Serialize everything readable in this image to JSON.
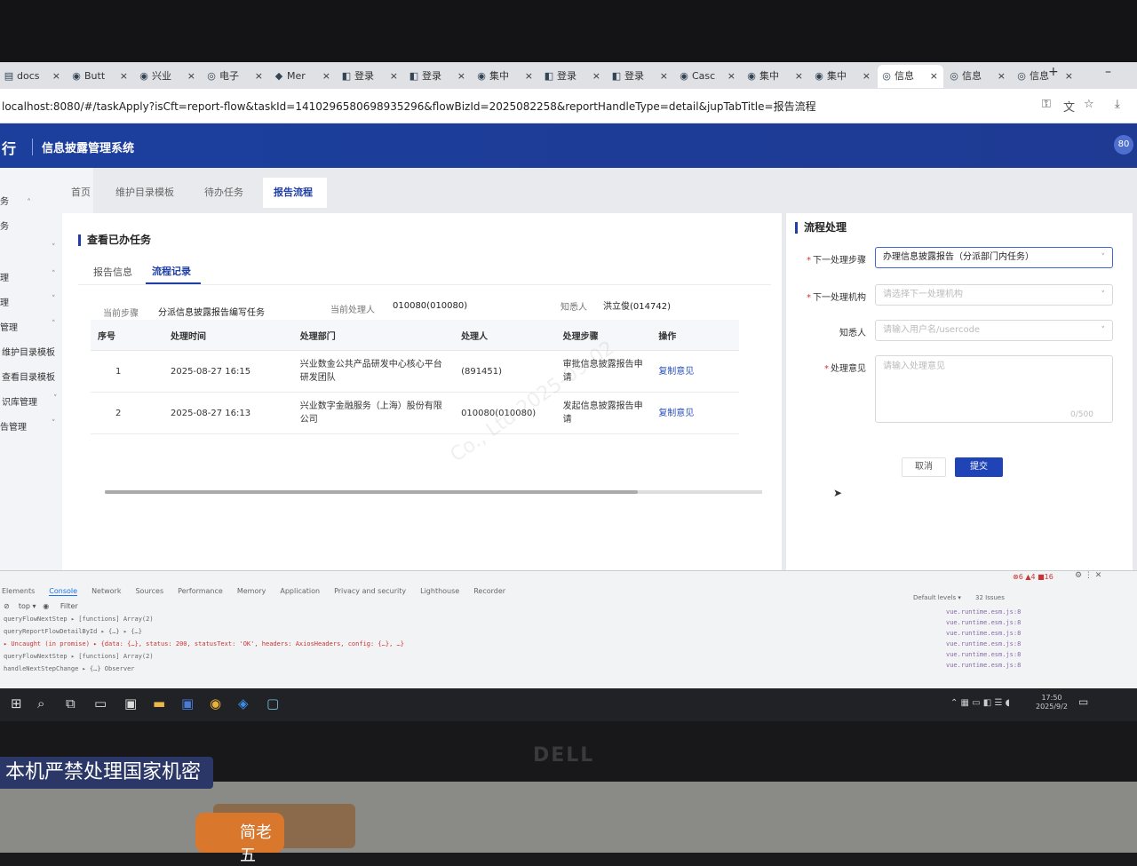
{
  "browser": {
    "tabs": [
      {
        "label": "docs",
        "icon": "doc"
      },
      {
        "label": "Butt",
        "icon": "globe"
      },
      {
        "label": "兴业",
        "icon": "globe"
      },
      {
        "label": "电子",
        "icon": "eye"
      },
      {
        "label": "Mer",
        "icon": "gitlab"
      },
      {
        "label": "登录",
        "icon": "d"
      },
      {
        "label": "登录",
        "icon": "d"
      },
      {
        "label": "集中",
        "icon": "globe"
      },
      {
        "label": "登录",
        "icon": "d"
      },
      {
        "label": "登录",
        "icon": "d"
      },
      {
        "label": "Casc",
        "icon": "globe"
      },
      {
        "label": "集中",
        "icon": "globe"
      },
      {
        "label": "集中",
        "icon": "globe"
      },
      {
        "label": "信息",
        "icon": "eye",
        "active": true
      },
      {
        "label": "信息",
        "icon": "eye"
      },
      {
        "label": "信息",
        "icon": "eye"
      }
    ],
    "close_glyph": "×",
    "new_tab_glyph": "+",
    "minimize_glyph": "–",
    "url": "localhost:8080/#/taskApply?isCft=report-flow&taskId=1410296580698935296&flowBizId=2025082258&reportHandleType=detail&jupTabTitle=报告流程"
  },
  "app": {
    "logo_fragment": "行",
    "title": "信息披露管理系统",
    "user_badge": "80"
  },
  "sidebar": {
    "items": [
      {
        "label": "务",
        "chevron": ""
      },
      {
        "label": "务",
        "chevron": ""
      },
      {
        "label": "",
        "chevron": "˅"
      },
      {
        "label": "理",
        "chevron": "˄"
      },
      {
        "label": "理",
        "chevron": "˅"
      },
      {
        "label": "管理",
        "chevron": "˄"
      },
      {
        "label": "维护目录模板",
        "chevron": ""
      },
      {
        "label": "查看目录模板",
        "chevron": ""
      },
      {
        "label": "识库管理",
        "chevron": "˅"
      },
      {
        "label": "告管理",
        "chevron": "˅"
      }
    ],
    "collapse_glyph": "˄"
  },
  "page_tabs": [
    {
      "label": "首页",
      "closable": false
    },
    {
      "label": "维护目录模板",
      "closable": true
    },
    {
      "label": "待办任务",
      "closable": true
    },
    {
      "label": "报告流程",
      "closable": true,
      "active": true
    }
  ],
  "main": {
    "title": "查看已办任务",
    "subtabs": [
      "报告信息",
      "流程记录"
    ],
    "current_step_label": "当前步骤",
    "current_step_value": "分派信息披露报告编写任务",
    "current_handler_label": "当前处理人",
    "current_handler_value": "010080(010080)",
    "notify_label": "知悉人",
    "notify_value": "洪立俊(014742)",
    "table": {
      "headers": [
        "序号",
        "处理时间",
        "处理部门",
        "处理人",
        "处理步骤",
        "操作"
      ],
      "rows": [
        {
          "no": "1",
          "time": "2025-08-27 16:15",
          "dept": "兴业数金公共产品研发中心核心平台研发团队",
          "person": "(891451)",
          "step": "审批信息披露报告申请",
          "action": "复制意见"
        },
        {
          "no": "2",
          "time": "2025-08-27 16:13",
          "dept": "兴业数字金融服务（上海）股份有限公司",
          "person": "010080(010080)",
          "step": "发起信息披露报告申请",
          "action": "复制意见"
        }
      ]
    },
    "watermark": "Co., Ltd 2025-09-02"
  },
  "flow_panel": {
    "title": "流程处理",
    "next_step_label": "下一处理步骤",
    "next_step_value": "办理信息披露报告（分派部门内任务）",
    "next_org_label": "下一处理机构",
    "next_org_placeholder": "请选择下一处理机构",
    "notify_label": "知悉人",
    "notify_placeholder": "请输入用户名/usercode",
    "remark_label": "处理意见",
    "remark_placeholder": "请输入处理意见",
    "remark_counter": "0/500",
    "cancel_label": "取消",
    "submit_label": "提交"
  },
  "devtools": {
    "tabs": [
      "Elements",
      "Console",
      "Network",
      "Sources",
      "Performance",
      "Memory",
      "Application",
      "Privacy and security",
      "Lighthouse",
      "Recorder"
    ],
    "active_tab": "Console",
    "filter_context": "top ▾",
    "filter_label": "Filter",
    "levels": "Default levels ▾",
    "issues": "32 Issues",
    "lines": [
      {
        "text": "queryFlowNextStep  ▸ [functions]  Array(2)",
        "err": false
      },
      {
        "text": "queryReportFlowDetailById  ▸ {…}  ▸ {…}",
        "err": false
      },
      {
        "text": "▸ Uncaught (in promise) ▸ {data: {…}, status: 200, statusText: 'OK', headers: AxiosHeaders, config: {…}, …}",
        "err": true
      },
      {
        "text": "queryFlowNextStep  ▸ [functions]  Array(2)",
        "err": false
      },
      {
        "text": "handleNextStepChange  ▸ {…}  Observer",
        "err": false
      }
    ],
    "right_links": [
      "vue.runtime.esm.js:8",
      "vue.runtime.esm.js:8",
      "vue.runtime.esm.js:8",
      "vue.runtime.esm.js:8",
      "vue.runtime.esm.js:8",
      "vue.runtime.esm.js:8"
    ],
    "status": "⊗6 ▲4 ■16"
  },
  "taskbar": {
    "time": "17:50",
    "date": "2025/9/2"
  },
  "photo": {
    "monitor_brand": "DELL",
    "sticker": "本机严禁处理国家机密",
    "desk_item_text": "简老五"
  }
}
